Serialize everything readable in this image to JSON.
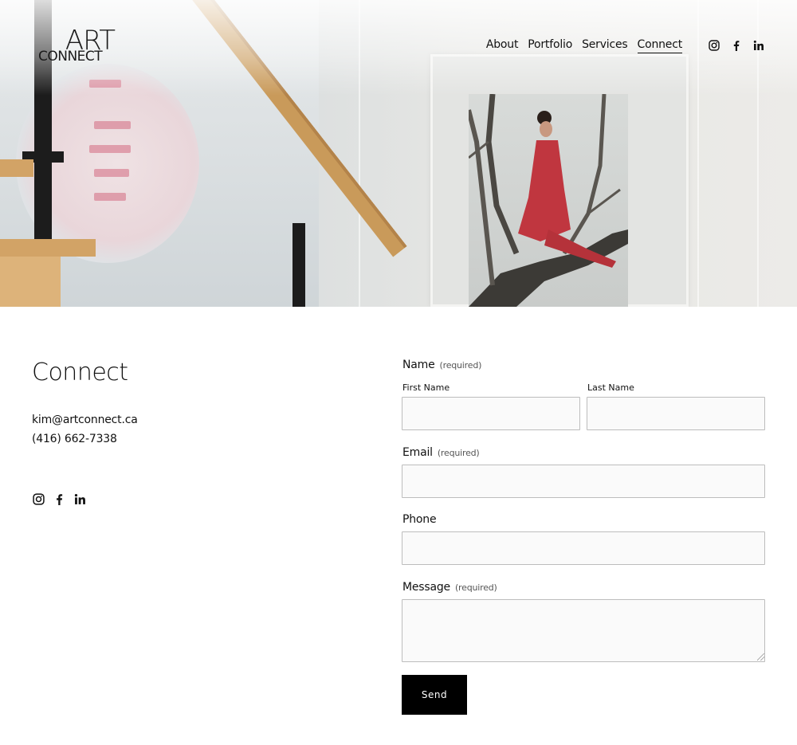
{
  "brand": {
    "logo_top": "ART",
    "logo_bottom": "CONNECT"
  },
  "nav": {
    "items": [
      {
        "label": "About"
      },
      {
        "label": "Portfolio"
      },
      {
        "label": "Services"
      },
      {
        "label": "Connect",
        "active": true
      }
    ],
    "social": [
      "instagram-icon",
      "facebook-icon",
      "linkedin-icon"
    ]
  },
  "contact": {
    "title": "Connect",
    "email": "kim@artconnect.ca",
    "phone": "(416) 662-7338",
    "social": [
      "instagram-icon",
      "facebook-icon",
      "linkedin-icon"
    ]
  },
  "form": {
    "name_label": "Name",
    "name_required": "(required)",
    "first_name_label": "First Name",
    "last_name_label": "Last Name",
    "first_name_value": "",
    "last_name_value": "",
    "email_label": "Email",
    "email_required": "(required)",
    "email_value": "",
    "phone_label": "Phone",
    "phone_value": "",
    "message_label": "Message",
    "message_required": "(required)",
    "message_value": "",
    "send_label": "Send"
  },
  "colors": {
    "button_bg": "#000000",
    "button_text": "#ffffff",
    "input_bg": "#fafafa",
    "input_border": "#bdbdbd"
  }
}
